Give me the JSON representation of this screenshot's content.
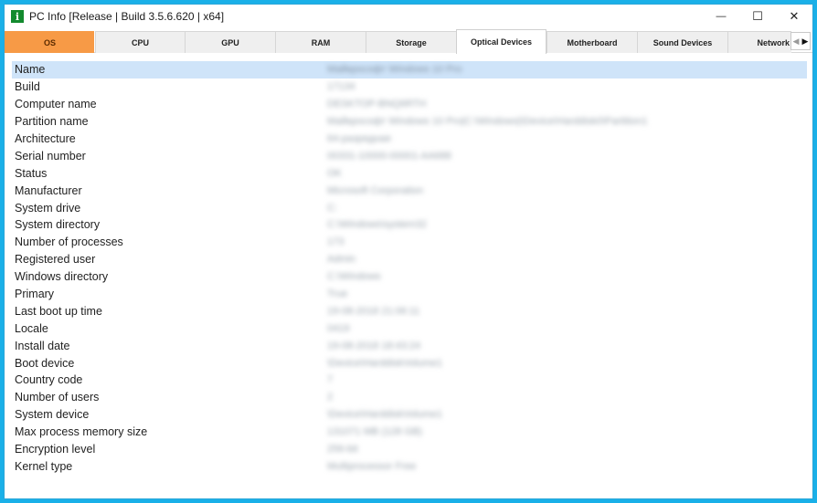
{
  "window": {
    "title": "PC Info [Release | Build 3.5.6.620 | x64]",
    "icon_letter": "i",
    "icon": "app-info-icon",
    "controls": {
      "minimize": "—",
      "maximize": "☐",
      "close": "✕"
    }
  },
  "tabs": [
    {
      "label": "OS"
    },
    {
      "label": "CPU"
    },
    {
      "label": "GPU"
    },
    {
      "label": "RAM"
    },
    {
      "label": "Storage"
    },
    {
      "label": "Optical Devices"
    },
    {
      "label": "Motherboard"
    },
    {
      "label": "Sound Devices"
    },
    {
      "label": "Network"
    }
  ],
  "tab_scroll": {
    "left": "◀",
    "right": "▶"
  },
  "properties": [
    {
      "label": "Name",
      "value": "Майкрософт Windows 10 Pro"
    },
    {
      "label": "Build",
      "value": "17134"
    },
    {
      "label": "Computer name",
      "value": "DESKTOP-BNQ6RTH"
    },
    {
      "label": "Partition name",
      "value": "Майкрософт Windows 10 Pro|C:\\Windows|\\Device\\Harddisk0\\Partition1"
    },
    {
      "label": "Architecture",
      "value": "64-разрядная"
    },
    {
      "label": "Serial number",
      "value": "00331-10000-00001-AA688"
    },
    {
      "label": "Status",
      "value": "OK"
    },
    {
      "label": "Manufacturer",
      "value": "Microsoft Corporation"
    },
    {
      "label": "System drive",
      "value": "C:"
    },
    {
      "label": "System directory",
      "value": "C:\\Windows\\system32"
    },
    {
      "label": "Number of processes",
      "value": "173"
    },
    {
      "label": "Registered user",
      "value": "Admin"
    },
    {
      "label": "Windows directory",
      "value": "C:\\Windows"
    },
    {
      "label": "Primary",
      "value": "True"
    },
    {
      "label": "Last boot up time",
      "value": "19-08-2018 21:06:11"
    },
    {
      "label": "Locale",
      "value": "0419"
    },
    {
      "label": "Install date",
      "value": "19-08-2018 18:43:24"
    },
    {
      "label": "Boot device",
      "value": "\\Device\\HarddiskVolume1"
    },
    {
      "label": "Country code",
      "value": "7"
    },
    {
      "label": "Number of users",
      "value": "2"
    },
    {
      "label": "System device",
      "value": "\\Device\\HarddiskVolume1"
    },
    {
      "label": "Max process memory size",
      "value": "131071 MB (128 GB)"
    },
    {
      "label": "Encryption level",
      "value": "256-bit"
    },
    {
      "label": "Kernel type",
      "value": "Multiprocessor Free"
    }
  ]
}
